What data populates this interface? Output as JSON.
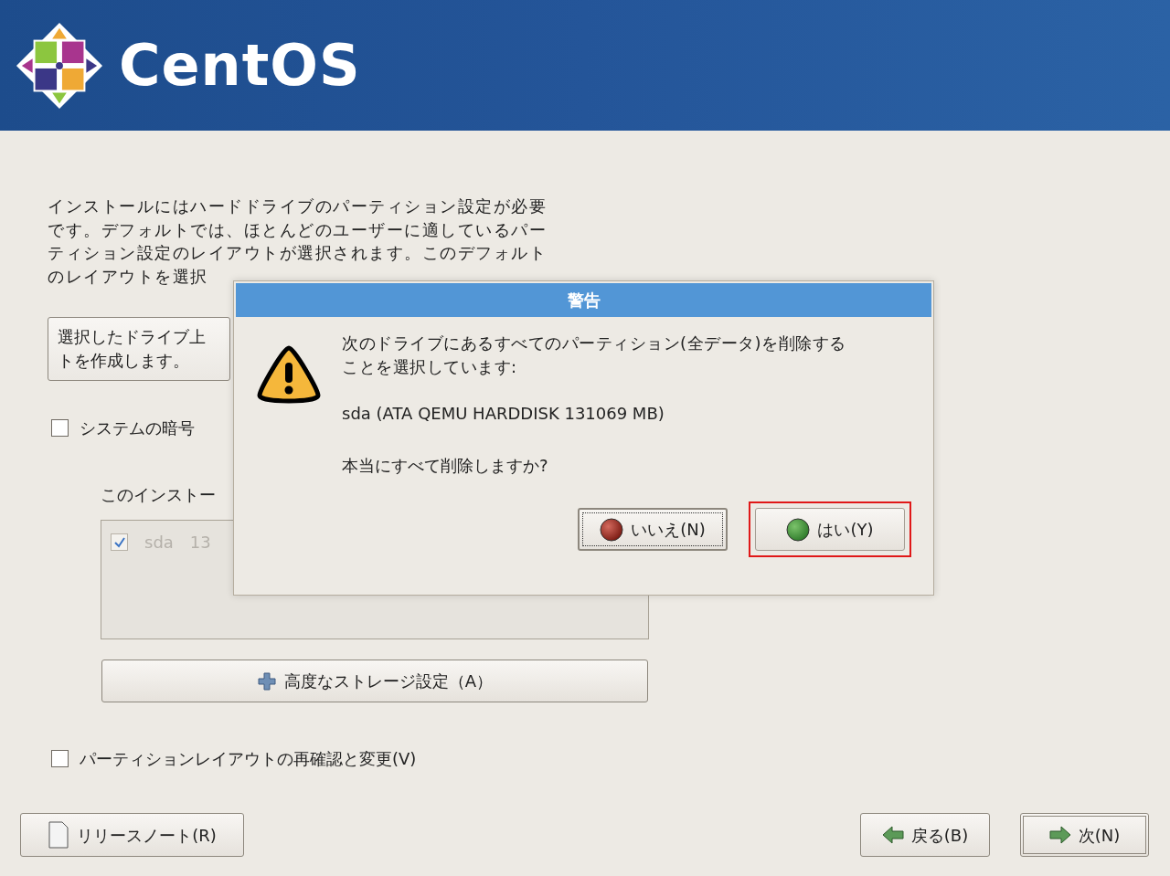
{
  "header": {
    "logo_text": "CentOS"
  },
  "intro": {
    "lines": [
      "インストールにはハードドライブのパーティション設定が必要",
      "です。デフォルトでは、ほとんどのユーザーに適しているパー",
      "ティション設定のレイアウトが選択されます。このデフォルト",
      "のレイアウトを選択"
    ]
  },
  "layout_combo": {
    "lines": [
      "選択したドライブ上",
      "トを作成します。"
    ]
  },
  "encrypt": {
    "label": "システムの暗号",
    "checked": false
  },
  "drive_prompt": "このインストー",
  "drive_list": {
    "disabled": true,
    "drives": [
      {
        "name": "sda",
        "size": "13",
        "checked": true
      }
    ]
  },
  "advanced_button": "高度なストレージ設定（A）",
  "review": {
    "label": "パーティションレイアウトの再確認と変更(V)",
    "checked": false
  },
  "release_notes_button": "リリースノート(R)",
  "back_button": "戻る(B)",
  "next_button": "次(N)",
  "dialog": {
    "title": "警告",
    "message": [
      "次のドライブにあるすべてのパーティション(全データ)を削除する",
      "ことを選択しています:"
    ],
    "drive": "sda (ATA QEMU HARDDISK 131069 MB)",
    "question": "本当にすべて削除しますか?",
    "buttons": [
      {
        "label": "いいえ(N)",
        "kind": "no",
        "focused": true,
        "annotated": false
      },
      {
        "label": "はい(Y)",
        "kind": "yes",
        "focused": false,
        "annotated": true
      }
    ]
  }
}
